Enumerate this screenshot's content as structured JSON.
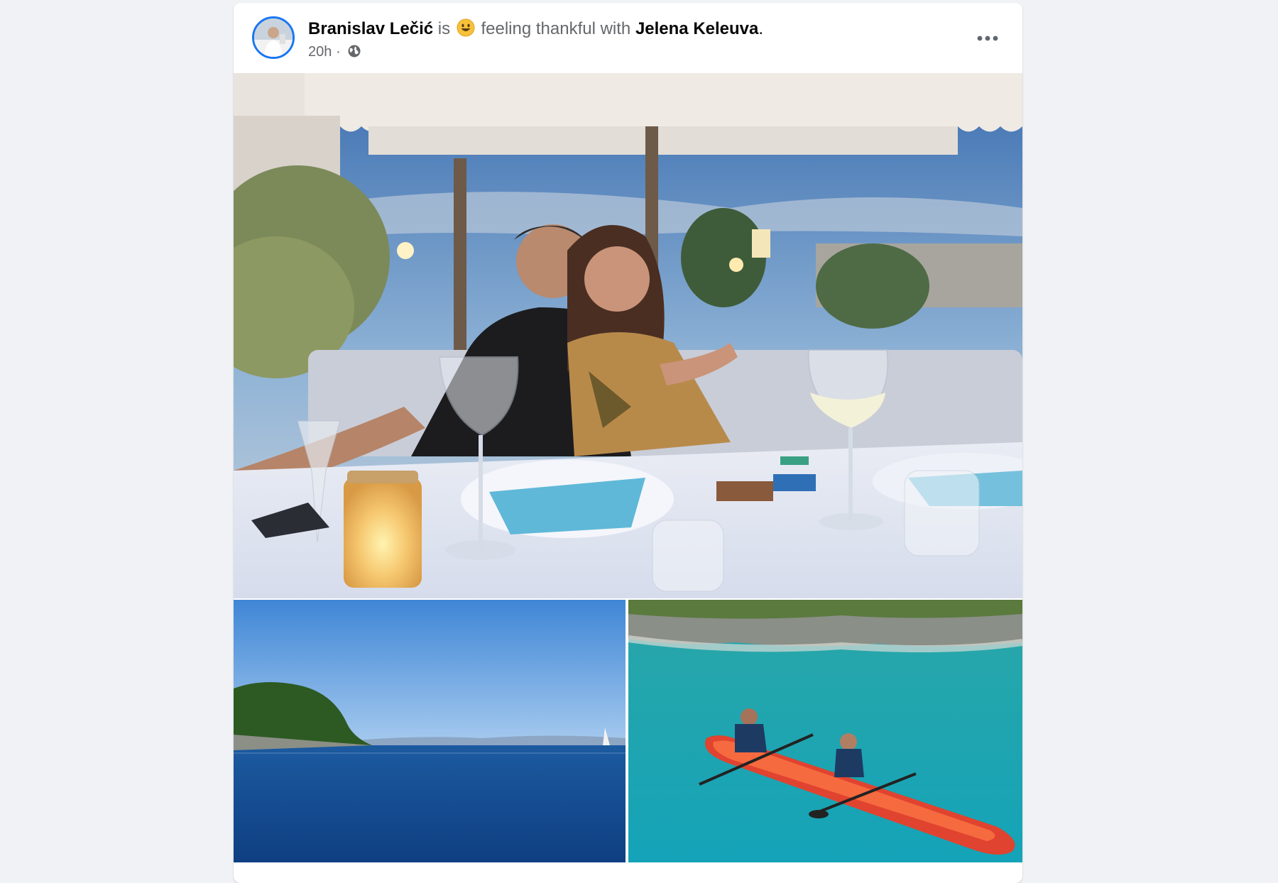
{
  "post": {
    "author_name": "Branislav Lečić",
    "verb_is": "is",
    "feeling_text": "feeling thankful with",
    "tagged_name": "Jelena Keleuva",
    "period": ".",
    "timestamp": "20h",
    "separator": "·",
    "privacy_icon": "globe-icon",
    "more_icon": "more-options-icon",
    "feeling_emoji": "smiling-face-emoji"
  },
  "photos": [
    {
      "subject": "couple at restaurant table at dusk"
    },
    {
      "subject": "sea with island"
    },
    {
      "subject": "couple in red kayak on turquoise water"
    }
  ],
  "colors": {
    "accent": "#1877f2",
    "page_bg": "#f0f2f5",
    "text_primary": "#050505",
    "text_secondary": "#65676b"
  }
}
